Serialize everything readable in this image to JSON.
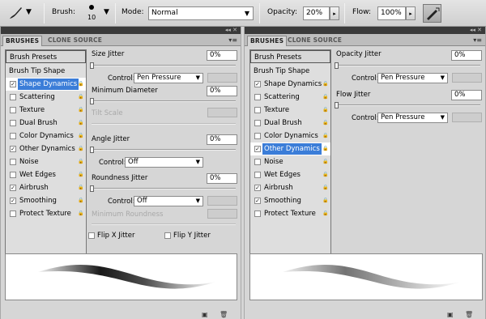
{
  "options_bar": {
    "brush_label": "Brush:",
    "brush_size": "10",
    "mode_label": "Mode:",
    "mode_value": "Normal",
    "opacity_label": "Opacity:",
    "opacity_value": "20%",
    "flow_label": "Flow:",
    "flow_value": "100%"
  },
  "left_panel": {
    "tabs": [
      "BRUSHES",
      "CLONE SOURCE"
    ],
    "brush_presets": "Brush Presets",
    "brush_tip_shape": "Brush Tip Shape",
    "items": [
      {
        "label": "Shape Dynamics",
        "checked": true,
        "selected": true
      },
      {
        "label": "Scattering",
        "checked": false
      },
      {
        "label": "Texture",
        "checked": false
      },
      {
        "label": "Dual Brush",
        "checked": false
      },
      {
        "label": "Color Dynamics",
        "checked": false
      },
      {
        "label": "Other Dynamics",
        "checked": true
      },
      {
        "label": "Noise",
        "checked": false
      },
      {
        "label": "Wet Edges",
        "checked": false
      },
      {
        "label": "Airbrush",
        "checked": true
      },
      {
        "label": "Smoothing",
        "checked": true
      },
      {
        "label": "Protect Texture",
        "checked": false
      }
    ],
    "size_jitter_label": "Size Jitter",
    "size_jitter_value": "0%",
    "control_label": "Control:",
    "size_control": "Pen Pressure",
    "min_diameter_label": "Minimum Diameter",
    "min_diameter_value": "0%",
    "tilt_scale_label": "Tilt Scale",
    "angle_jitter_label": "Angle Jitter",
    "angle_jitter_value": "0%",
    "angle_control": "Off",
    "roundness_jitter_label": "Roundness Jitter",
    "roundness_jitter_value": "0%",
    "roundness_control": "Off",
    "min_roundness_label": "Minimum Roundness",
    "flip_x_label": "Flip X Jitter",
    "flip_y_label": "Flip Y Jitter"
  },
  "right_panel": {
    "tabs": [
      "BRUSHES",
      "CLONE SOURCE"
    ],
    "brush_presets": "Brush Presets",
    "brush_tip_shape": "Brush Tip Shape",
    "items": [
      {
        "label": "Shape Dynamics",
        "checked": true
      },
      {
        "label": "Scattering",
        "checked": false
      },
      {
        "label": "Texture",
        "checked": false
      },
      {
        "label": "Dual Brush",
        "checked": false
      },
      {
        "label": "Color Dynamics",
        "checked": false
      },
      {
        "label": "Other Dynamics",
        "checked": true,
        "selected": true
      },
      {
        "label": "Noise",
        "checked": false
      },
      {
        "label": "Wet Edges",
        "checked": false
      },
      {
        "label": "Airbrush",
        "checked": true
      },
      {
        "label": "Smoothing",
        "checked": true
      },
      {
        "label": "Protect Texture",
        "checked": false
      }
    ],
    "opacity_jitter_label": "Opacity Jitter",
    "opacity_jitter_value": "0%",
    "control_label": "Control:",
    "opacity_control": "Pen Pressure",
    "flow_jitter_label": "Flow Jitter",
    "flow_jitter_value": "0%",
    "flow_control": "Pen Pressure"
  },
  "colors": {
    "selection": "#3b7dd8",
    "panel_bg": "#d6d6d6"
  }
}
